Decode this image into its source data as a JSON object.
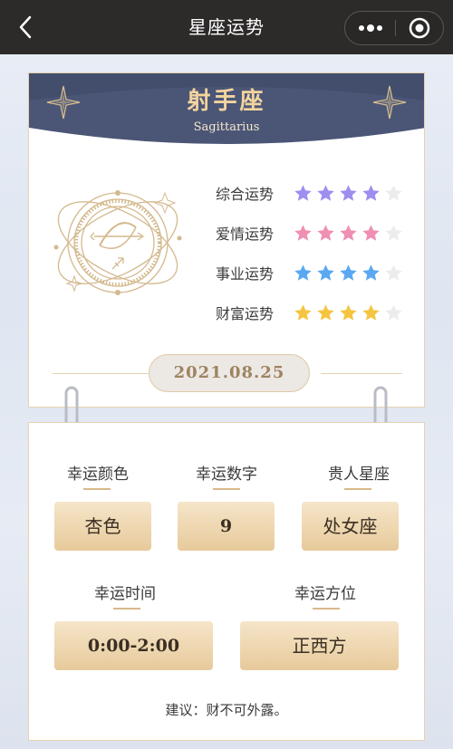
{
  "nav": {
    "title": "星座运势",
    "back_icon": "back-chevron-icon",
    "more_icon": "more-dots-icon",
    "target_icon": "target-circle-icon"
  },
  "sign": {
    "name_cn": "射手座",
    "name_en": "Sagittarius",
    "banner_color": "#4b5676",
    "emblem_icon": "sagittarius-archer-icon"
  },
  "ratings": [
    {
      "label": "综合运势",
      "stars": 4,
      "max": 5,
      "color": "#9d8ff0"
    },
    {
      "label": "爱情运势",
      "stars": 4,
      "max": 5,
      "color": "#ef8fb3"
    },
    {
      "label": "事业运势",
      "stars": 4,
      "max": 5,
      "color": "#5aa8f1"
    },
    {
      "label": "财富运势",
      "stars": 4,
      "max": 5,
      "color": "#f5c542"
    }
  ],
  "date": "2021.08.25",
  "lucky": {
    "color": {
      "label": "幸运颜色",
      "value": "杏色"
    },
    "number": {
      "label": "幸运数字",
      "value": "9"
    },
    "noble": {
      "label": "贵人星座",
      "value": "处女座"
    },
    "time": {
      "label": "幸运时间",
      "value": "0:00-2:00"
    },
    "direction": {
      "label": "幸运方位",
      "value": "正西方"
    }
  },
  "advice": "建议：财不可外露。"
}
